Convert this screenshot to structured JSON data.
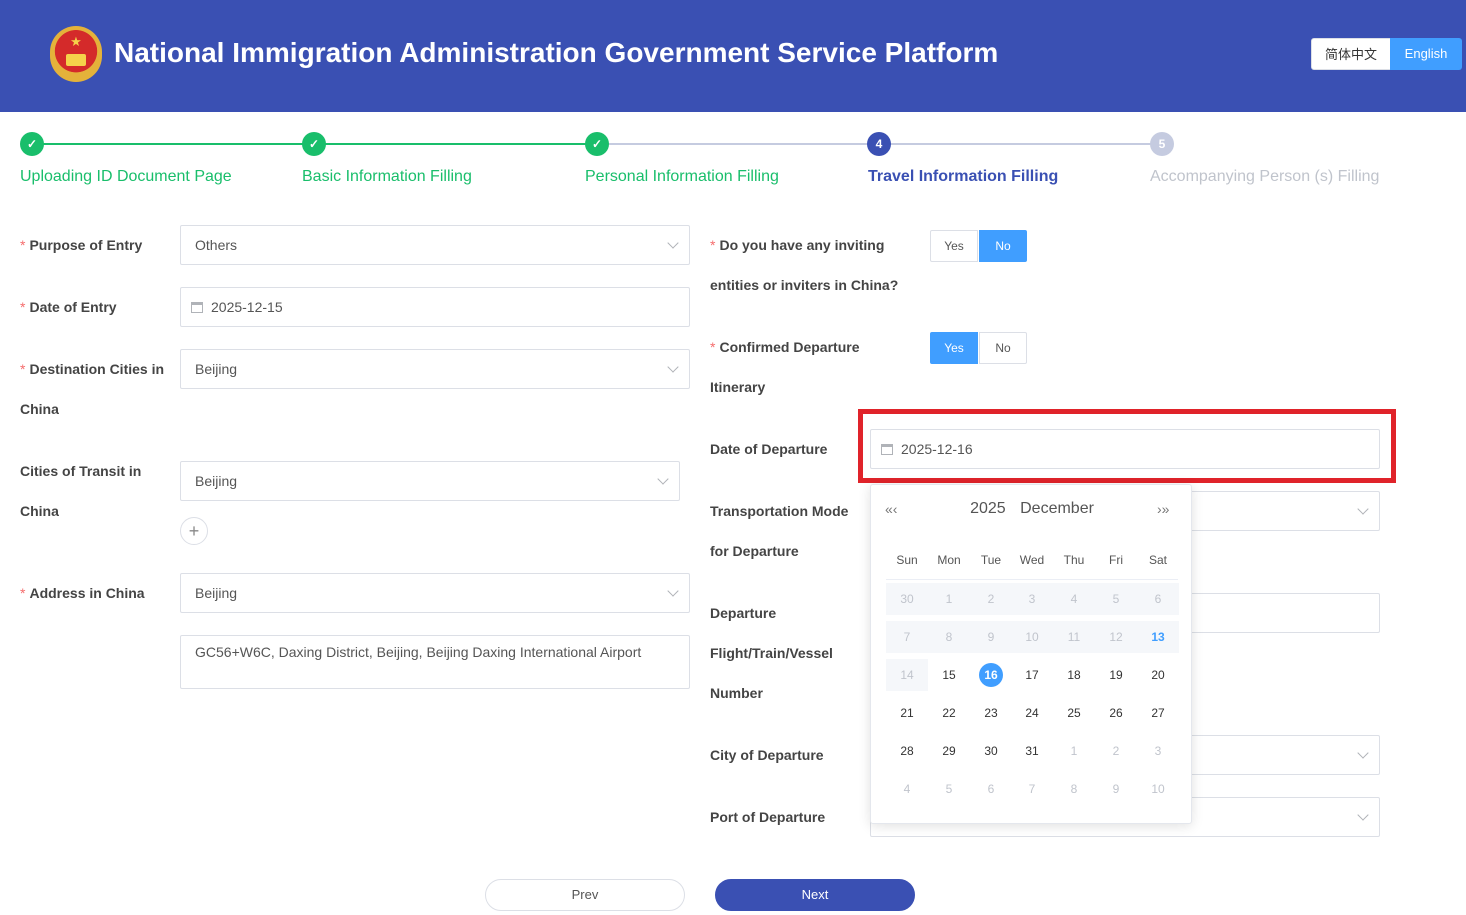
{
  "header": {
    "title": "National Immigration Administration Government Service Platform",
    "lang_cn": "简体中文",
    "lang_en": "English",
    "colors": {
      "bar": "#3a50b3",
      "accent": "#409eff"
    }
  },
  "steps": [
    {
      "label": "Uploading ID Document Page",
      "state": "done"
    },
    {
      "label": "Basic Information Filling",
      "state": "done"
    },
    {
      "label": "Personal Information Filling",
      "state": "done"
    },
    {
      "number": "4",
      "label": "Travel Information Filling",
      "state": "active"
    },
    {
      "number": "5",
      "label": "Accompanying Person (s) Filling",
      "state": "pending"
    }
  ],
  "step_colors": {
    "done": "#19be6b",
    "active": "#3a50b3",
    "pending": "#c5cbe0"
  },
  "form_left": {
    "purpose": {
      "label_a": "Purpose of Entry",
      "value": "Others"
    },
    "date_entry": {
      "label_a": "Date of Entry",
      "value": "2025-12-15"
    },
    "dest_cities": {
      "label_a": "Destination Cities in",
      "label_b": "China",
      "value": "Beijing"
    },
    "transit_cities": {
      "label_a": "Cities of Transit in",
      "label_b": "China",
      "value": "Beijing",
      "add": "+"
    },
    "address": {
      "label_a": "Address in China",
      "value": "Beijing",
      "detail": "GC56+W6C, Daxing District, Beijing, Beijing Daxing International Airport"
    }
  },
  "form_right": {
    "inviting": {
      "label_a": "Do you have any inviting",
      "label_b": "entities or inviters in China?",
      "yes": "Yes",
      "no": "No",
      "selected": "No"
    },
    "confirmed": {
      "label_a": "Confirmed Departure",
      "label_b": "Itinerary",
      "yes": "Yes",
      "no": "No",
      "selected": "Yes"
    },
    "date_departure": {
      "label_a": "Date of Departure",
      "value": "2025-12-16"
    },
    "transport": {
      "label_a": "Transportation Mode",
      "label_b": "for Departure"
    },
    "flight": {
      "label_a": "Departure",
      "label_b": "Flight/Train/Vessel",
      "label_c": "Number"
    },
    "city_departure": {
      "label_a": "City of Departure"
    },
    "port_departure": {
      "label_a": "Port of Departure"
    }
  },
  "datepicker": {
    "year": "2025",
    "month": "December",
    "prev": "«‹",
    "next": "›»",
    "weekdays": [
      "Sun",
      "Mon",
      "Tue",
      "Wed",
      "Thu",
      "Fri",
      "Sat"
    ],
    "rows": [
      [
        "30",
        "1",
        "2",
        "3",
        "4",
        "5",
        "6"
      ],
      [
        "7",
        "8",
        "9",
        "10",
        "11",
        "12",
        "13"
      ],
      [
        "14",
        "15",
        "16",
        "17",
        "18",
        "19",
        "20"
      ],
      [
        "21",
        "22",
        "23",
        "24",
        "25",
        "26",
        "27"
      ],
      [
        "28",
        "29",
        "30",
        "31",
        "1",
        "2",
        "3"
      ],
      [
        "4",
        "5",
        "6",
        "7",
        "8",
        "9",
        "10"
      ]
    ],
    "today": "13",
    "selected": "16"
  },
  "buttons": {
    "prev": "Prev",
    "next": "Next"
  }
}
